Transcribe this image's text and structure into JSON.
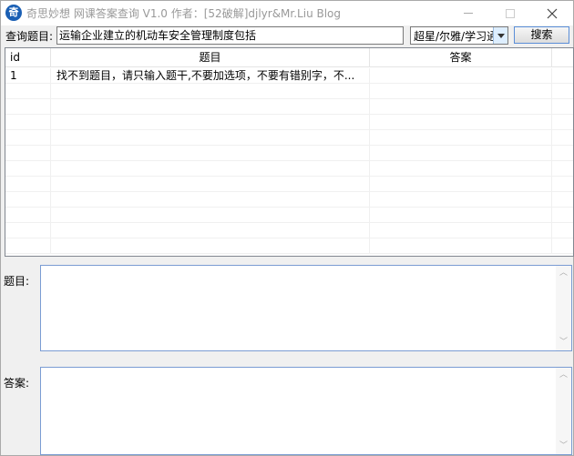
{
  "window": {
    "title": "奇思妙想 网课答案查询 V1.0 作者：[52破解]djlyr&Mr.Liu Blog",
    "icon_glyph": "奇"
  },
  "query": {
    "label": "查询题目:",
    "value": "运输企业建立的机动车安全管理制度包括"
  },
  "source_select": {
    "selected": "超星/尔雅/学习通"
  },
  "search_button": {
    "label": "搜索"
  },
  "table": {
    "columns": [
      "id",
      "题目",
      "答案"
    ],
    "rows": [
      {
        "id": "1",
        "question": "找不到题目，请只输入题干,不要加选项，不要有错别字，不...",
        "answer": ""
      }
    ]
  },
  "question_field": {
    "label": "题目:"
  },
  "answer_field": {
    "label": "答案:"
  },
  "icons": {
    "minimize": "minimize-icon",
    "maximize": "maximize-icon",
    "close": "close-icon",
    "dropdown": "chevron-down-icon"
  }
}
